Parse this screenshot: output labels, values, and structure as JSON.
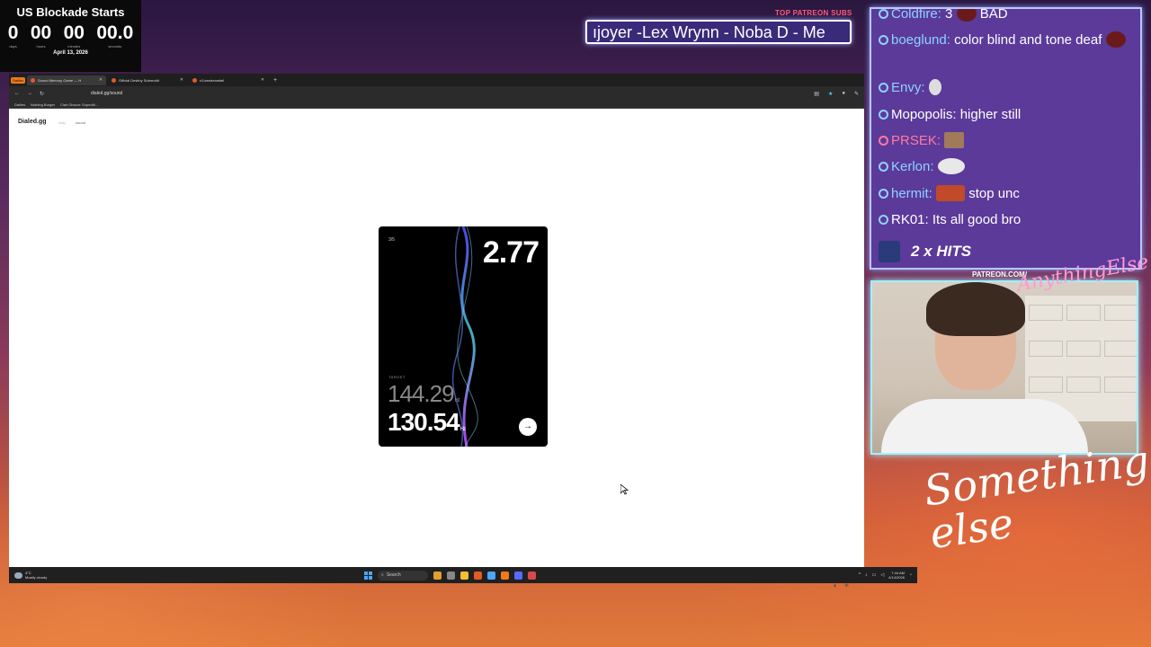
{
  "countdown": {
    "title": "US Blockade Starts",
    "units": [
      {
        "value": "0",
        "label": "days"
      },
      {
        "value": "00",
        "label": "hours"
      },
      {
        "value": "00",
        "label": "minutes"
      },
      {
        "value": "00.0",
        "label": "seconds"
      }
    ],
    "date": "April 13, 2026"
  },
  "patreon_subs": {
    "label": "TOP PATREON SUBS",
    "ticker": "ıjoyer -Lex Wrynn -  Noba D - Me"
  },
  "browser": {
    "tabs": [
      {
        "label": "Sound Memory Game — H",
        "active": true
      },
      {
        "label": "Official Destiny Subreddit",
        "active": false
      },
      {
        "label": "r/Livestreamfail",
        "active": false
      }
    ],
    "dailies_badge": "Dailies",
    "new_tab": "+",
    "url": "dialed.gg/sound",
    "bookmarks": [
      "Dailies",
      "Nothing Burger",
      "Clair Obscur: Expediti..."
    ]
  },
  "site": {
    "logo": "Dialed.gg",
    "nav_daily": "daily",
    "nav_sound": "sound"
  },
  "game_card": {
    "round": "3/5",
    "score": "2.77",
    "target_label": "TARGET",
    "target_value": "144.29",
    "your_value": "130.54",
    "unit": "Hz",
    "next_glyph": "→"
  },
  "taskbar": {
    "weather_temp": "4°C",
    "weather_desc": "Mostly cloudy",
    "search_label": "Search",
    "time": "7:44 AM",
    "date": "4/14/2026",
    "app_colors": [
      "#e0a030",
      "#888888",
      "#f0c030",
      "#e05a2a",
      "#4aa8ff",
      "#f07a1a",
      "#5a6aff",
      "#d84a4a"
    ]
  },
  "chat": {
    "messages": [
      {
        "user": "Coldfire:",
        "text": "3",
        "emote_color": "#6a1a1a",
        "after": "BAD",
        "pink": false
      },
      {
        "user": "boeglund:",
        "text": "color blind and tone deaf",
        "emote_color": "#6a1a1a",
        "pink": false
      },
      {
        "user": "Envy:",
        "text": "",
        "emote_color": "#dddddd",
        "pink": false
      },
      {
        "user": "Mopopolis:",
        "text": "higher still",
        "pink": false
      },
      {
        "user": "PRSEK:",
        "text": "",
        "emote_color": "#a07a5a",
        "pink": true
      },
      {
        "user": "Kerlon:",
        "text": "",
        "emote_color": "#e8e8e8",
        "pink": false
      },
      {
        "user": "hermit:",
        "text": "stop unc",
        "emote_color": "#c04a2a",
        "pink": false
      },
      {
        "user": "RK01:",
        "text": "Its all good bro",
        "pink": false
      }
    ],
    "hits_label": "2 x HITS"
  },
  "overlay": {
    "patreon_label": "PATREON.COM/",
    "brand": "AnythingElse",
    "script": "Something else"
  }
}
